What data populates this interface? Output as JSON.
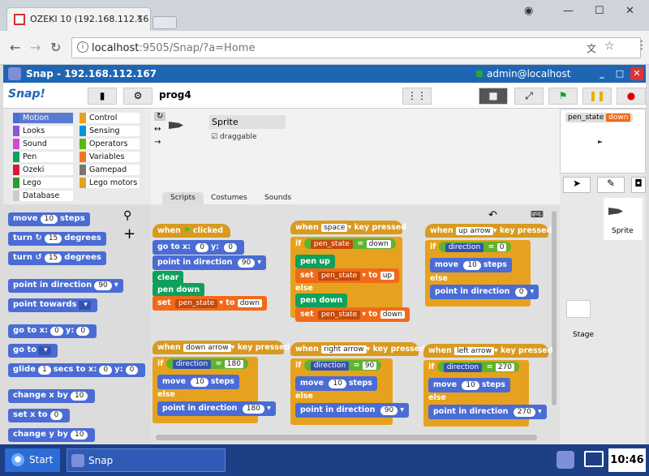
{
  "browser": {
    "tab_title": "OZEKI 10 (192.168.112.16",
    "url_host": "localhost",
    "url_rest": ":9505/Snap/?a=Home"
  },
  "snapbar": {
    "title": "Snap - 192.168.112.167",
    "user": "admin@localhost"
  },
  "toolbar": {
    "logo": "Snap!",
    "project": "prog4"
  },
  "categories": [
    {
      "label": "Motion",
      "color": "#4a6cd4"
    },
    {
      "label": "Control",
      "color": "#e6a21e"
    },
    {
      "label": "Looks",
      "color": "#8a55d7"
    },
    {
      "label": "Sensing",
      "color": "#0494dc"
    },
    {
      "label": "Sound",
      "color": "#cf4ad9"
    },
    {
      "label": "Operators",
      "color": "#5cb712"
    },
    {
      "label": "Pen",
      "color": "#0ea05c"
    },
    {
      "label": "Variables",
      "color": "#f3761d"
    },
    {
      "label": "Ozeki",
      "color": "#d6193a"
    },
    {
      "label": "Gamepad",
      "color": "#777777"
    },
    {
      "label": "Lego",
      "color": "#2e9b2e"
    },
    {
      "label": "Lego motors",
      "color": "#e6a21e"
    },
    {
      "label": "Database",
      "color": "#cccccc"
    }
  ],
  "palette": {
    "move": "move",
    "move_n": "10",
    "steps": "steps",
    "turn": "turn",
    "turn_n": "15",
    "degrees": "degrees",
    "pid": "point in direction",
    "pid_v": "90",
    "pt": "point towards",
    "goto": "go to x:",
    "y": "y:",
    "zero": "0",
    "goto2": "go to",
    "glide": "glide",
    "glide_n": "1",
    "secs": "secs to x:",
    "cx": "change x by",
    "cx_n": "10",
    "sx": "set x to",
    "sx_n": "0",
    "cy": "change y by",
    "cy_n": "10"
  },
  "sprite": {
    "name": "Sprite",
    "draggable": "draggable"
  },
  "script_tabs": [
    "Scripts",
    "Costumes",
    "Sounds"
  ],
  "scripts": {
    "when": "when",
    "clicked": "clicked",
    "key_pressed": "key pressed",
    "goto": "go to x:",
    "y": "y:",
    "zero": "0",
    "pid": "point in direction",
    "v90": "90",
    "v180": "180",
    "v270": "270",
    "v0": "0",
    "clear": "clear",
    "pen_down": "pen down",
    "pen_up": "pen up",
    "set": "set",
    "to": "to",
    "pen_state": "pen_state",
    "down": "down",
    "up": "up",
    "if": "if",
    "else": "else",
    "eq": "=",
    "direction": "direction",
    "move": "move",
    "ten": "10",
    "steps": "steps",
    "space": "space",
    "up_arrow": "up arrow",
    "down_arrow": "down arrow",
    "right_arrow": "right arrow",
    "left_arrow": "left arrow"
  },
  "stage": {
    "var_name": "pen_state",
    "var_value": "down",
    "label": "Stage"
  },
  "taskbar": {
    "start": "Start",
    "app": "Snap",
    "time": "10:46"
  }
}
